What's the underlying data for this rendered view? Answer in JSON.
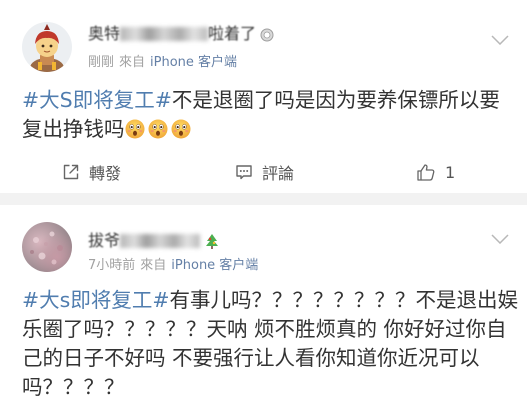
{
  "theme": {
    "accent": "#507daf",
    "text": "#333333",
    "meta_text": "#a2a2a2",
    "source_link": "#6580a6",
    "page_background": "#f2f2f2",
    "card_background": "#ffffff"
  },
  "icons": {
    "more": "chevron-down-icon",
    "repost": "share-icon",
    "comment": "comment-icon",
    "like": "thumbs-up-icon",
    "emoji": "astonished-face-icon"
  },
  "posts": [
    {
      "user": {
        "name_start": "奥特",
        "name_end": "啦着了",
        "badge": "gray-badge-icon"
      },
      "time": "剛剛",
      "source_prefix": "來自",
      "source": "iPhone 客户端",
      "hashtag": "#大S即将复工#",
      "body_lines": [
        "不是退圈了吗是因为要养保镖所以要",
        "复出挣钱吗"
      ],
      "emojis": [
        "astonished-face-icon",
        "astonished-face-icon",
        "astonished-face-icon"
      ],
      "actions": {
        "repost_label": "轉發",
        "comment_label": "評論",
        "like_count": "1"
      }
    },
    {
      "user": {
        "name_start": "拔爷",
        "badge": "colorful-badge-icon"
      },
      "time": "7小時前",
      "source_prefix": "來自",
      "source": "iPhone 客户端",
      "hashtag": "#大s即将复工#",
      "body_lines": [
        "有事儿吗？？？？？？？？不是退出娱",
        "乐圈了吗？？？？？天呐 烦不胜烦真的 你好好过你自",
        "己的日子不好吗 不要强行让人看你知道你近况可以",
        "吗？？？？"
      ]
    }
  ]
}
